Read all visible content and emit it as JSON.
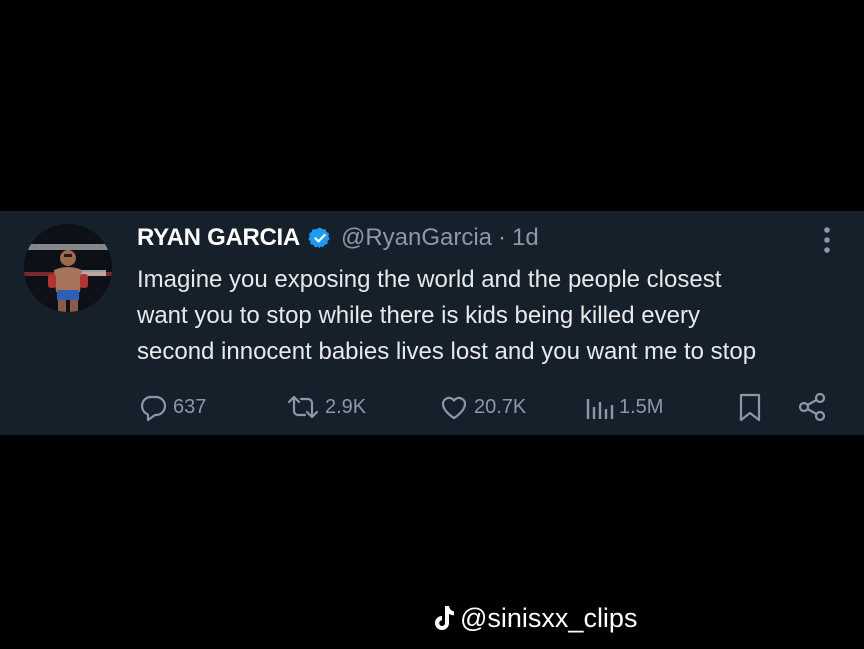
{
  "colors": {
    "page_background": "#000000",
    "card_background": "#15202b",
    "primary_text": "#e7e9ea",
    "secondary_text": "#8b98a5",
    "verified_blue": "#1d9bf0"
  },
  "tweet": {
    "author": {
      "display_name": "RYAN GARCIA",
      "handle": "@RyanGarcia",
      "separator": "·",
      "age": "1d",
      "verified": true,
      "avatar_icon": "avatar-boxer-photo"
    },
    "text_lines": [
      "Imagine you exposing the world and the people closest",
      "want you to stop while there is kids being killed every",
      "second innocent babies lives lost and you want me to stop"
    ],
    "actions": {
      "replies": {
        "icon": "reply-icon",
        "count": "637"
      },
      "reposts": {
        "icon": "repost-icon",
        "count": "2.9K"
      },
      "likes": {
        "icon": "heart-icon",
        "count": "20.7K"
      },
      "views": {
        "icon": "views-icon",
        "count": "1.5M"
      },
      "bookmark": {
        "icon": "bookmark-icon"
      },
      "share": {
        "icon": "share-icon"
      }
    },
    "more_icon": "more-vertical-icon"
  },
  "watermark": {
    "icon": "tiktok-icon",
    "text": "@sinisxx_clips"
  }
}
